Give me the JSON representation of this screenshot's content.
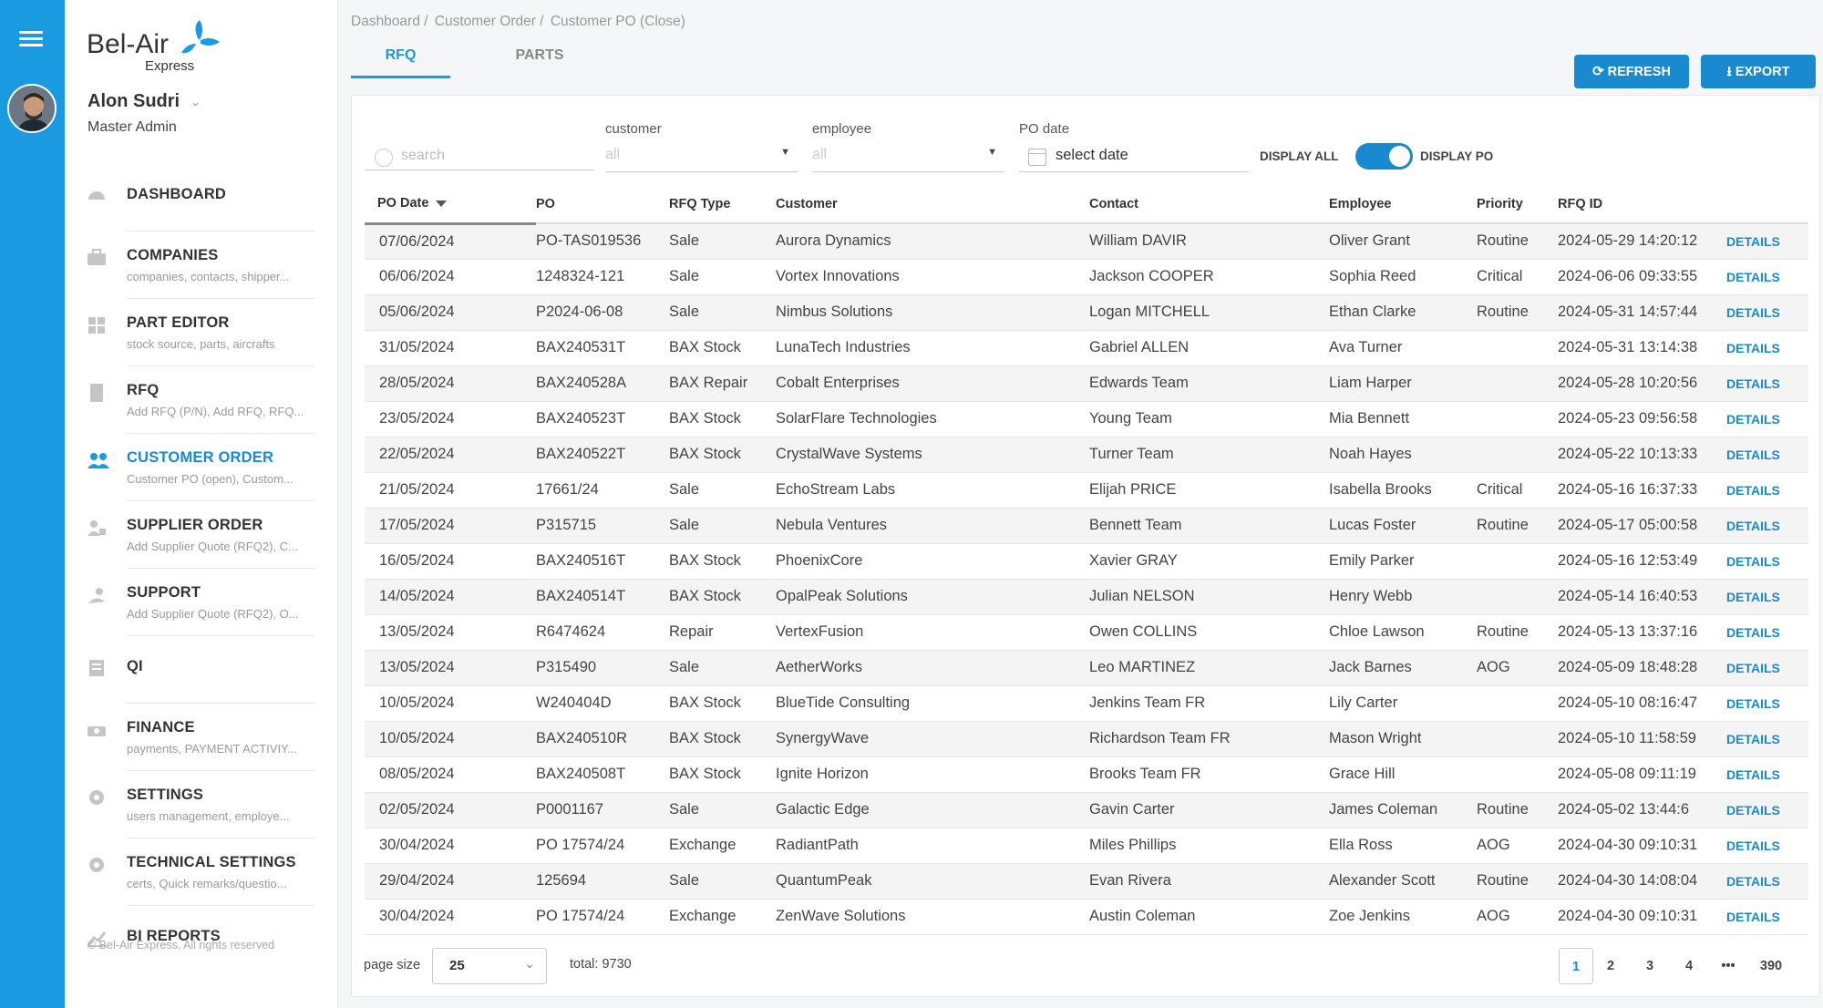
{
  "brand": {
    "name": "Bel-Air",
    "sub": "Express"
  },
  "user": {
    "name": "Alon Sudri",
    "role": "Master Admin"
  },
  "nav": [
    {
      "label": "DASHBOARD",
      "sub": "",
      "icon": "dashboard-icon"
    },
    {
      "label": "COMPANIES",
      "sub": "companies, contacts, shipper...",
      "icon": "briefcase-icon"
    },
    {
      "label": "PART EDITOR",
      "sub": "stock source, parts, aircrafts",
      "icon": "grid-icon"
    },
    {
      "label": "RFQ",
      "sub": "Add RFQ (P/N), Add RFQ, RFQ...",
      "icon": "document-icon"
    },
    {
      "label": "CUSTOMER ORDER",
      "sub": "Customer PO (open), Custom...",
      "icon": "users-icon"
    },
    {
      "label": "SUPPLIER ORDER",
      "sub": "Add Supplier Quote (RFQ2), C...",
      "icon": "supplier-icon"
    },
    {
      "label": "SUPPORT",
      "sub": "Add Supplier Quote (RFQ2), O...",
      "icon": "support-icon"
    },
    {
      "label": "QI",
      "sub": "",
      "icon": "qi-icon"
    },
    {
      "label": "FINANCE",
      "sub": "payments, PAYMENT ACTIVIY...",
      "icon": "finance-icon"
    },
    {
      "label": "SETTINGS",
      "sub": "users management, employe...",
      "icon": "settings-icon"
    },
    {
      "label": "TECHNICAL SETTINGS",
      "sub": "certs, Quick remarks/questio...",
      "icon": "tech-settings-icon"
    },
    {
      "label": "BI REPORTS",
      "sub": "",
      "icon": "chart-icon"
    }
  ],
  "copyright": "© Bel-Air Express. All rights reserved",
  "breadcrumb": [
    "Dashboard /",
    "Customer Order /",
    "Customer PO (Close)"
  ],
  "tabs": [
    "RFQ",
    "PARTS"
  ],
  "buttons": {
    "refresh": "REFRESH",
    "export": "EXPORT"
  },
  "filters": {
    "search_placeholder": "search",
    "customer_label": "customer",
    "customer_value": "all",
    "employee_label": "employee",
    "employee_value": "all",
    "date_label": "PO date",
    "date_value": "select date",
    "display_all": "DISPLAY ALL",
    "display_po": "DISPLAY PO"
  },
  "columns": [
    "PO Date",
    "PO",
    "RFQ Type",
    "Customer",
    "Contact",
    "Employee",
    "Priority",
    "RFQ ID",
    ""
  ],
  "details_label": "DETAILS",
  "rows": [
    [
      "07/06/2024",
      "PO-TAS019536",
      "Sale",
      "Aurora Dynamics",
      "William DAVIR",
      "Oliver Grant",
      "Routine",
      "2024-05-29 14:20:12"
    ],
    [
      "06/06/2024",
      "1248324-121",
      "Sale",
      "Vortex Innovations",
      "Jackson COOPER",
      "Sophia Reed",
      "Critical",
      "2024-06-06 09:33:55"
    ],
    [
      "05/06/2024",
      "P2024-06-08",
      "Sale",
      "Nimbus Solutions",
      "Logan MITCHELL",
      "Ethan Clarke",
      "Routine",
      "2024-05-31 14:57:44"
    ],
    [
      "31/05/2024",
      "BAX240531T",
      "BAX Stock",
      "LunaTech Industries",
      "Gabriel ALLEN",
      "Ava Turner",
      "",
      "2024-05-31 13:14:38"
    ],
    [
      "28/05/2024",
      "BAX240528A",
      "BAX Repair",
      "Cobalt Enterprises",
      "Edwards Team",
      "Liam Harper",
      "",
      "2024-05-28 10:20:56"
    ],
    [
      "23/05/2024",
      "BAX240523T",
      "BAX Stock",
      "SolarFlare Technologies",
      "Young Team",
      "Mia Bennett",
      "",
      "2024-05-23 09:56:58"
    ],
    [
      "22/05/2024",
      "BAX240522T",
      "BAX Stock",
      "CrystalWave Systems",
      "Turner Team",
      "Noah Hayes",
      "",
      "2024-05-22 10:13:33"
    ],
    [
      "21/05/2024",
      "17661/24",
      "Sale",
      "EchoStream Labs",
      "Elijah PRICE",
      "Isabella Brooks",
      "Critical",
      "2024-05-16 16:37:33"
    ],
    [
      "17/05/2024",
      "P315715",
      "Sale",
      "Nebula Ventures",
      "Bennett Team",
      "Lucas Foster",
      "Routine",
      "2024-05-17 05:00:58"
    ],
    [
      "16/05/2024",
      "BAX240516T",
      "BAX Stock",
      "PhoenixCore",
      "Xavier GRAY",
      "Emily Parker",
      "",
      "2024-05-16 12:53:49"
    ],
    [
      "14/05/2024",
      "BAX240514T",
      "BAX Stock",
      "OpalPeak Solutions",
      "Julian NELSON",
      "Henry Webb",
      "",
      "2024-05-14 16:40:53"
    ],
    [
      "13/05/2024",
      "R6474624",
      "Repair",
      "VertexFusion",
      "Owen COLLINS",
      "Chloe Lawson",
      "Routine",
      "2024-05-13 13:37:16"
    ],
    [
      "13/05/2024",
      "P315490",
      "Sale",
      "AetherWorks",
      "Leo MARTINEZ",
      "Jack Barnes",
      "AOG",
      "2024-05-09 18:48:28"
    ],
    [
      "10/05/2024",
      "W240404D",
      "BAX Stock",
      "BlueTide Consulting",
      "Jenkins Team FR",
      "Lily Carter",
      "",
      "2024-05-10 08:16:47"
    ],
    [
      "10/05/2024",
      "BAX240510R",
      "BAX Stock",
      "SynergyWave",
      "Richardson Team FR",
      "Mason Wright",
      "",
      "2024-05-10 11:58:59"
    ],
    [
      "08/05/2024",
      "BAX240508T",
      "BAX Stock",
      "Ignite Horizon",
      "Brooks Team FR",
      "Grace Hill",
      "",
      "2024-05-08 09:11:19"
    ],
    [
      "02/05/2024",
      "P0001167",
      "Sale",
      "Galactic Edge",
      "Gavin Carter",
      "James Coleman",
      "Routine",
      "2024-05-02 13:44:6"
    ],
    [
      "30/04/2024",
      "PO 17574/24",
      "Exchange",
      "RadiantPath",
      "Miles Phillips",
      "Ella Ross",
      "AOG",
      "2024-04-30 09:10:31"
    ],
    [
      "29/04/2024",
      "125694",
      "Sale",
      "QuantumPeak",
      "Evan Rivera",
      "Alexander Scott",
      "Routine",
      "2024-04-30 14:08:04"
    ],
    [
      "30/04/2024",
      "PO 17574/24",
      "Exchange",
      "ZenWave Solutions",
      "Austin Coleman",
      "Zoe Jenkins",
      "AOG",
      "2024-04-30 09:10:31"
    ]
  ],
  "pager": {
    "page_size_label": "page size",
    "page_size": "25",
    "total": "total: 9730",
    "pages": [
      "1",
      "2",
      "3",
      "4",
      "•••",
      "390"
    ],
    "current": "1"
  },
  "colors": {
    "accent": "#1a8ad0",
    "rail": "#1a9ae0"
  }
}
